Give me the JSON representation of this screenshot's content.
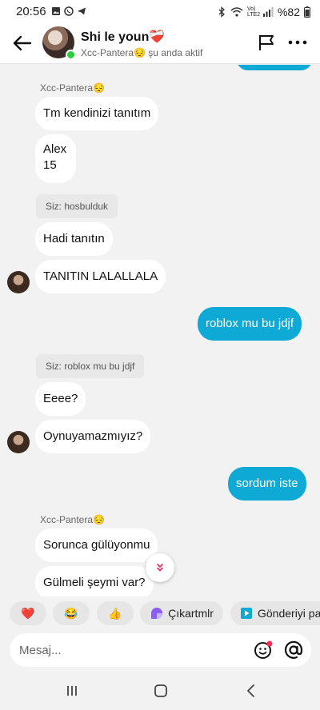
{
  "statusbar": {
    "time": "20:56",
    "battery": "%82",
    "network": "Vo) LTE2"
  },
  "header": {
    "title": "Shi le youn❤️‍🩹",
    "subtitle": "Xcc-Pantera😔 şu anda aktif"
  },
  "messages": [
    {
      "sender": "Xcc-Pantera😔"
    },
    {
      "text": "Tm kendinizi tanıtım"
    },
    {
      "line1": "Alex",
      "line2": "15"
    },
    {
      "reply": "Siz: hosbulduk"
    },
    {
      "text": "Hadi tanıtın"
    },
    {
      "text": "TANITIN LALALLALA"
    },
    {
      "text": "roblox mu bu jdjf"
    },
    {
      "reply": "Siz: roblox mu bu jdjf"
    },
    {
      "text": "Eeee?"
    },
    {
      "text": "Oynuyamazmıyız?"
    },
    {
      "text": "sordum iste"
    },
    {
      "sender": "Xcc-Pantera😔"
    },
    {
      "text": "Sorunca gülüyonmu"
    },
    {
      "text": "Gülmeli şeymi var?"
    }
  ],
  "quick_actions": {
    "heart": "❤️",
    "laugh": "😂",
    "thumbs": "👍",
    "stickers": "Çıkartmlr",
    "send_post": "Gönderiyi pa"
  },
  "composer": {
    "placeholder": "Mesaj..."
  },
  "colors": {
    "accent": "#0fa9d6",
    "online": "#2ecc40"
  }
}
